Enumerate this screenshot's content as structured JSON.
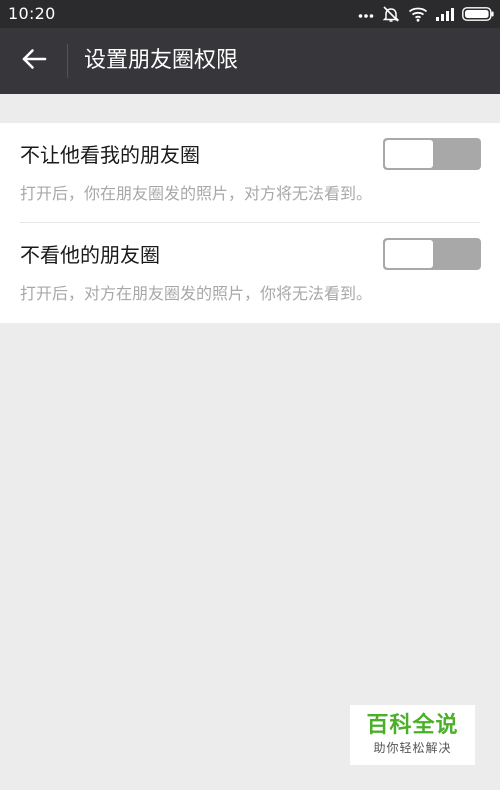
{
  "status_bar": {
    "time": "10:20",
    "icons": [
      "more-dots-icon",
      "alarm-off-icon",
      "wifi-icon",
      "signal-icon",
      "battery-icon"
    ]
  },
  "header": {
    "back_icon": "arrow-left-icon",
    "title": "设置朋友圈权限"
  },
  "settings": [
    {
      "label": "不让他看我的朋友圈",
      "description": "打开后，你在朋友圈发的照片，对方将无法看到。",
      "enabled": false
    },
    {
      "label": "不看他的朋友圈",
      "description": "打开后，对方在朋友圈发的照片，你将无法看到。",
      "enabled": false
    }
  ],
  "watermark": {
    "title": "百科全说",
    "subtitle": "助你轻松解决"
  },
  "colors": {
    "status_bar": "#2b2b2e",
    "title_bar": "#37373b",
    "page_background": "#ececec",
    "toggle_off": "#a8a8a8",
    "watermark_accent": "#4caf2a"
  }
}
